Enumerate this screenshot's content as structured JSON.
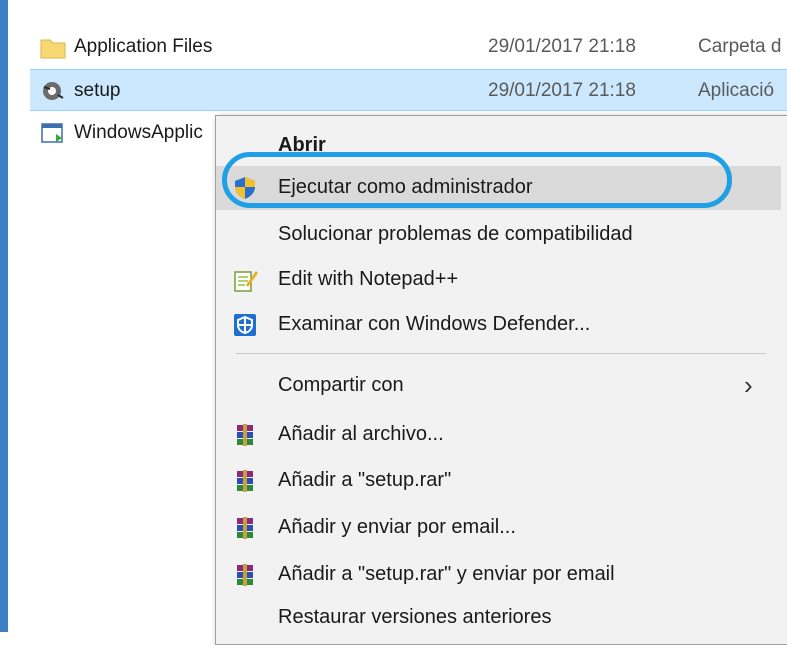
{
  "files": [
    {
      "name": "Application Files",
      "date": "29/01/2017 21:18",
      "type": "Carpeta d",
      "icon": "folder-icon"
    },
    {
      "name": "setup",
      "date": "29/01/2017 21:18",
      "type": "Aplicació",
      "icon": "setup-app-icon"
    },
    {
      "name": "WindowsApplic",
      "date": "",
      "type": "",
      "icon": "app-manifest-icon"
    }
  ],
  "menu": {
    "open": "Abrir",
    "run_as_admin": "Ejecutar como administrador",
    "troubleshoot": "Solucionar problemas de compatibilidad",
    "notepad": "Edit with Notepad++",
    "defender": "Examinar con Windows Defender...",
    "share": "Compartir con",
    "add_archive": "Añadir al archivo...",
    "add_rar": "Añadir a \"setup.rar\"",
    "add_email": "Añadir y enviar por email...",
    "add_rar_email": "Añadir a \"setup.rar\" y enviar por email",
    "restore": "Restaurar versiones anteriores"
  },
  "colors": {
    "selection": "#cce8ff",
    "highlight_ring": "#1e9fe6",
    "menu_bg": "#f2f2f2"
  }
}
